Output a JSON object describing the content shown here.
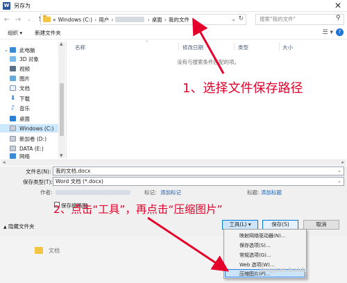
{
  "window": {
    "title": "另存为",
    "app_icon": "W"
  },
  "nav": {
    "breadcrumbs": [
      "«",
      "Windows (C:)",
      "用户",
      "桌面",
      "我的文件"
    ],
    "search_placeholder": "搜索\"我的文件\""
  },
  "toolbar": {
    "organize": "组织 ▾",
    "new_folder": "新建文件夹"
  },
  "sidebar": {
    "items": [
      "此电脑",
      "3D 对象",
      "视频",
      "图片",
      "文档",
      "下载",
      "音乐",
      "桌面",
      "Windows (C:)",
      "新加卷 (D:)",
      "DATA (E:)",
      "网络"
    ]
  },
  "filelist": {
    "columns": [
      "名称",
      "修改日期",
      "类型",
      "大小"
    ],
    "empty_message": "没有与搜索条件匹配的项。"
  },
  "save": {
    "filename_label": "文件名(N):",
    "filename_value": "我的文档.docx",
    "type_label": "保存类型(T):",
    "type_value": "Word 文档 (*.docx)",
    "author_label": "作者:",
    "tags_label": "标记:",
    "tags_link": "添加标记",
    "title_label": "标题:",
    "title_link": "添加标题",
    "thumbnail_label": "保存缩略图"
  },
  "bottom": {
    "hide_folders": "隐藏文件夹",
    "tools_button": "工具(L)",
    "save_button": "保存(S)",
    "cancel_button": "取消"
  },
  "tools_menu": {
    "items": [
      "映射网络驱动器(N)...",
      "保存选项(S)...",
      "常规选项(G)...",
      "Web 选项(W)...",
      "压缩图片(P)..."
    ]
  },
  "background": {
    "partial_text": "文档"
  },
  "annotations": {
    "step1": "1、选择文件保存路径",
    "step2": "2、点击“工具”，再点击“压缩图片”"
  },
  "watermark": "jingyan.baidu",
  "colors": {
    "annotation": "#e4002b",
    "selection": "#cce8ff",
    "accent": "#0078d7",
    "link": "#1a5fb4"
  }
}
